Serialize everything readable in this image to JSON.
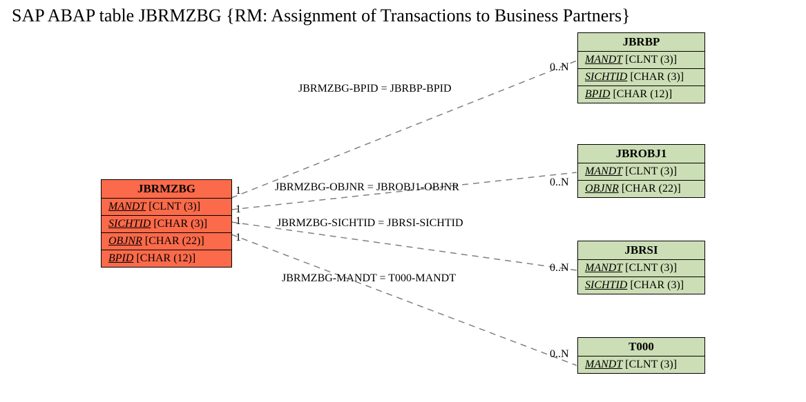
{
  "title": "SAP ABAP table JBRMZBG {RM: Assignment of Transactions to Business Partners}",
  "source": {
    "name": "JBRMZBG",
    "fields": [
      {
        "key": "MANDT",
        "type": "[CLNT (3)]"
      },
      {
        "key": "SICHTID",
        "type": "[CHAR (3)]"
      },
      {
        "key": "OBJNR",
        "type": "[CHAR (22)]"
      },
      {
        "key": "BPID",
        "type": "[CHAR (12)]"
      }
    ]
  },
  "targets": [
    {
      "name": "JBRBP",
      "fields": [
        {
          "key": "MANDT",
          "type": "[CLNT (3)]"
        },
        {
          "key": "SICHTID",
          "type": "[CHAR (3)]"
        },
        {
          "key": "BPID",
          "type": "[CHAR (12)]"
        }
      ]
    },
    {
      "name": "JBROBJ1",
      "fields": [
        {
          "key": "MANDT",
          "type": "[CLNT (3)]"
        },
        {
          "key": "OBJNR",
          "type": "[CHAR (22)]"
        }
      ]
    },
    {
      "name": "JBRSI",
      "fields": [
        {
          "key": "MANDT",
          "type": "[CLNT (3)]"
        },
        {
          "key": "SICHTID",
          "type": "[CHAR (3)]"
        }
      ]
    },
    {
      "name": "T000",
      "fields": [
        {
          "key": "MANDT",
          "type": "[CLNT (3)]"
        }
      ]
    }
  ],
  "relations": [
    {
      "label": "JBRMZBG-BPID = JBRBP-BPID",
      "sourceCard": "1",
      "targetCard": "0..N"
    },
    {
      "label": "JBRMZBG-OBJNR = JBROBJ1-OBJNR",
      "sourceCard": "1",
      "targetCard": "0..N"
    },
    {
      "label": "JBRMZBG-SICHTID = JBRSI-SICHTID",
      "sourceCard": "1",
      "targetCard": "0..N"
    },
    {
      "label": "JBRMZBG-MANDT = T000-MANDT",
      "sourceCard": "1",
      "targetCard": "0..N"
    }
  ]
}
